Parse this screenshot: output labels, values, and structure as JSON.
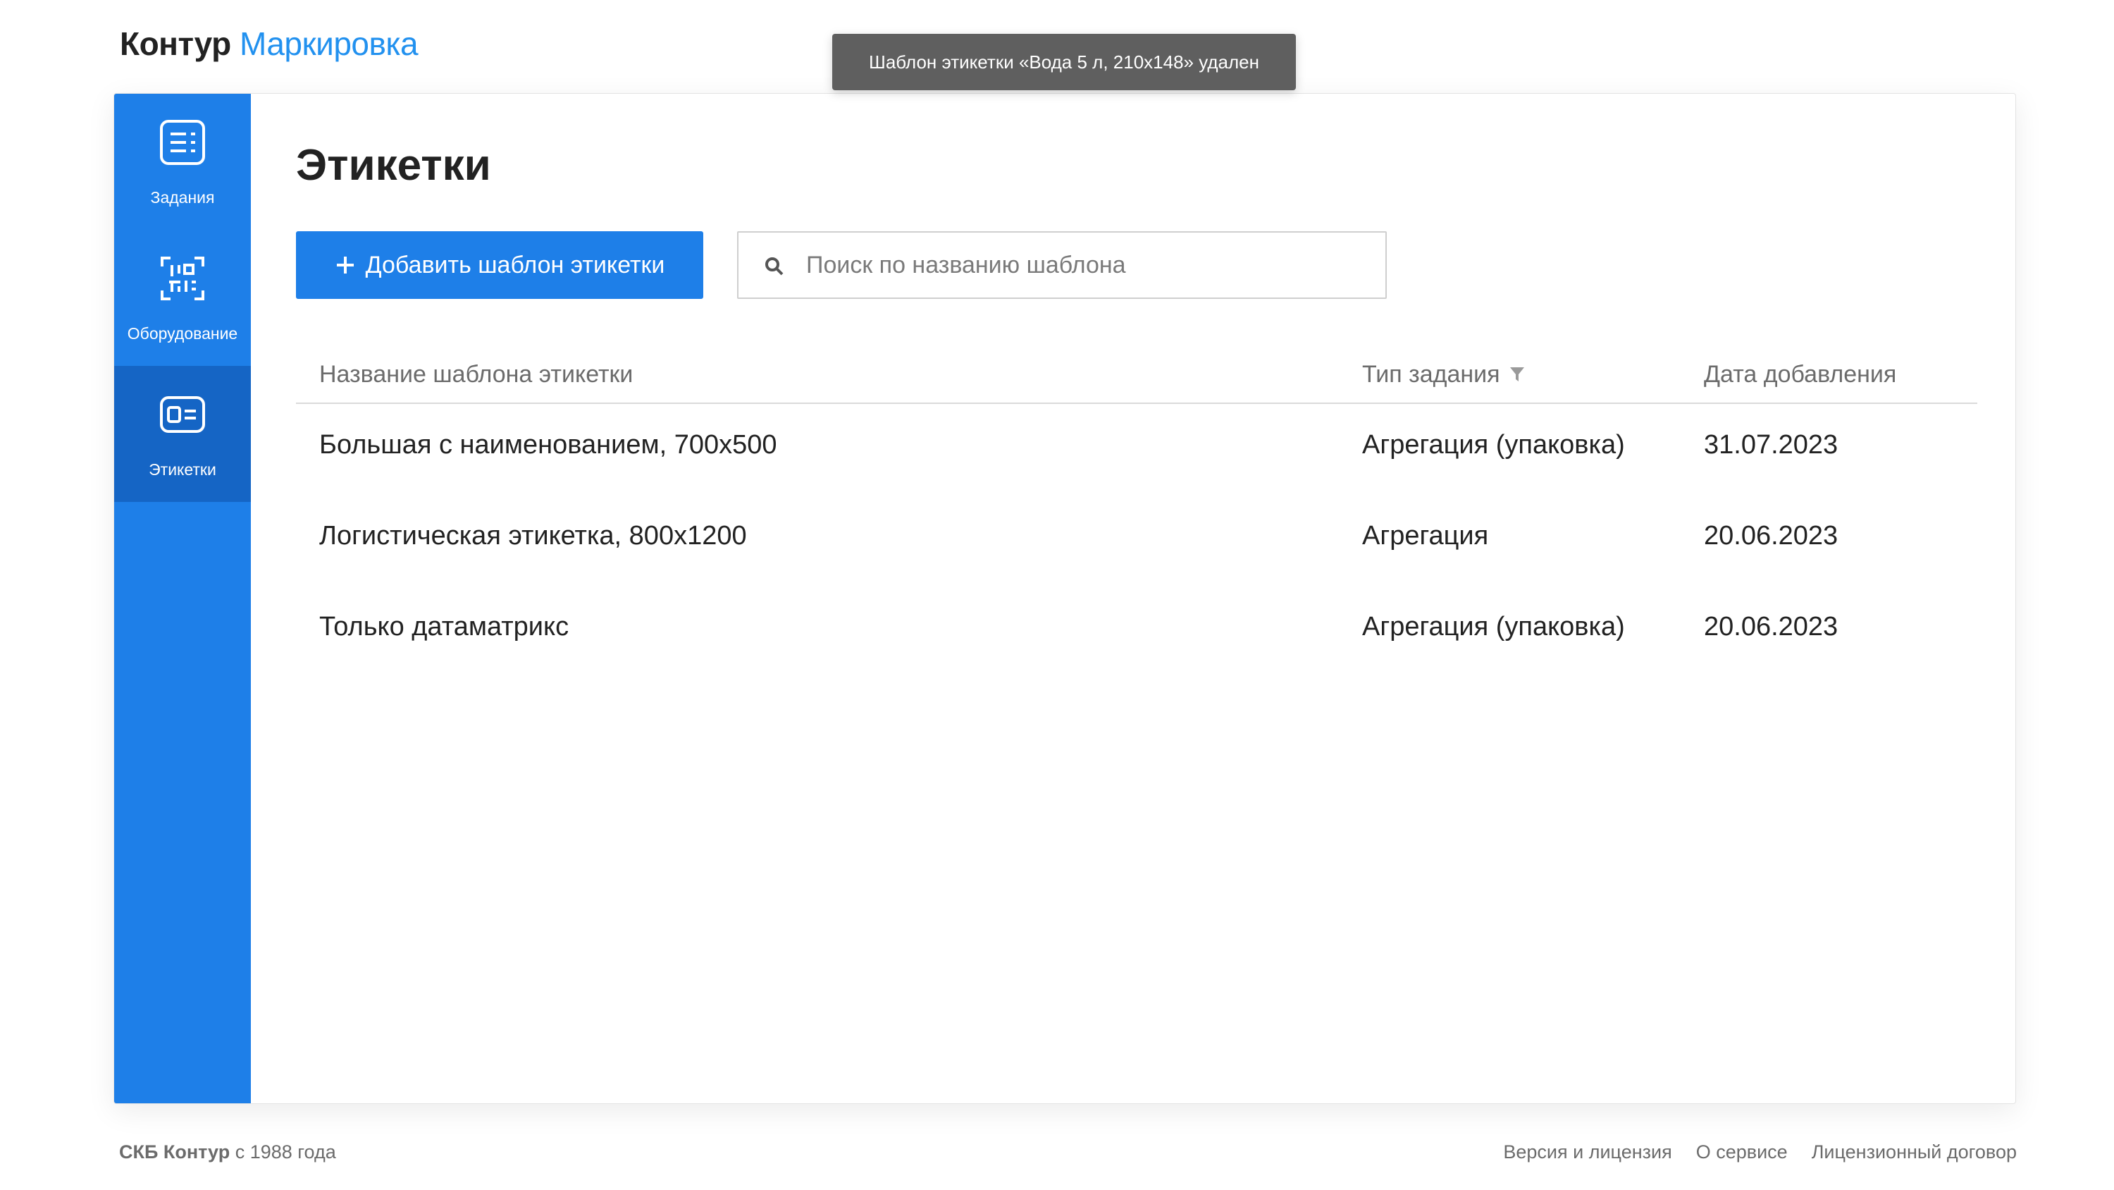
{
  "header": {
    "brand": "Контур",
    "product": "Маркировка"
  },
  "toast": {
    "message": "Шаблон этикетки «Вода 5 л, 210х148» удален"
  },
  "sidebar": {
    "items": [
      {
        "label": "Задания",
        "icon": "tasks-list-icon",
        "active": false
      },
      {
        "label": "Оборудование",
        "icon": "barcode-scanner-icon",
        "active": false
      },
      {
        "label": "Этикетки",
        "icon": "label-card-icon",
        "active": true
      }
    ]
  },
  "main": {
    "title": "Этикетки",
    "add_button_label": "Добавить шаблон этикетки",
    "search": {
      "placeholder": "Поиск по названию шаблона",
      "value": ""
    },
    "table": {
      "columns": [
        "Название шаблона этикетки",
        "Тип задания",
        "Дата добавления"
      ],
      "rows": [
        {
          "name": "Большая с наименованием, 700x500",
          "type": "Агрегация (упаковка)",
          "date": "31.07.2023"
        },
        {
          "name": "Логистическая этикетка, 800x1200",
          "type": "Агрегация",
          "date": "20.06.2023"
        },
        {
          "name": "Только датаматрикс",
          "type": "Агрегация (упаковка)",
          "date": "20.06.2023"
        }
      ]
    }
  },
  "footer": {
    "company": "СКБ Контур",
    "since": "с 1988 года",
    "links": [
      "Версия и лицензия",
      "О сервисе",
      "Лицензионный договор"
    ]
  },
  "colors": {
    "accent": "#1e7fe8",
    "sidebar_active": "#1565c5",
    "product_text": "#2291ef",
    "toast_bg": "#5f5f5f"
  }
}
